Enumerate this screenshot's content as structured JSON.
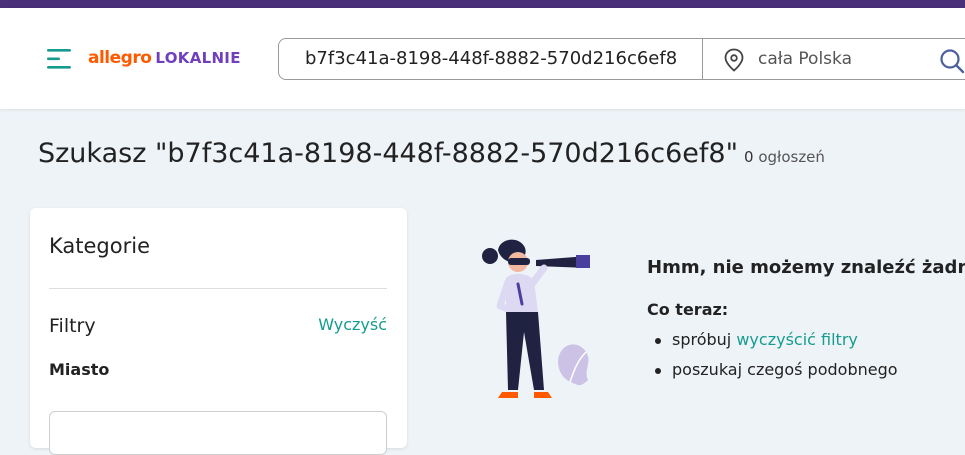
{
  "header": {
    "logo_primary": "allegro",
    "logo_secondary": "LOKALNIE",
    "search_query": "b7f3c41a-8198-448f-8882-570d216c6ef8",
    "location_placeholder": "cała Polska"
  },
  "results": {
    "title": "Szukasz \"b7f3c41a-8198-448f-8882-570d216c6ef8\"",
    "count": "0",
    "count_label": "ogłoszeń"
  },
  "sidebar": {
    "categories_title": "Kategorie",
    "filters_title": "Filtry",
    "clear_label": "Wyczyść",
    "city_label": "Miasto"
  },
  "empty_state": {
    "message": "Hmm, nie możemy znaleźć żadne",
    "what_now": "Co teraz:",
    "tip1_prefix": "spróbuj",
    "tip1_link": "wyczyścić filtry",
    "tip2": "poszukaj czegoś podobnego"
  },
  "colors": {
    "top_stripe": "#4a2f79",
    "accent_teal": "#169c8e",
    "logo_orange": "#ff5a00",
    "logo_purple": "#6f3fbf"
  },
  "icons": [
    "menu-icon",
    "location-pin-icon",
    "search-icon"
  ]
}
